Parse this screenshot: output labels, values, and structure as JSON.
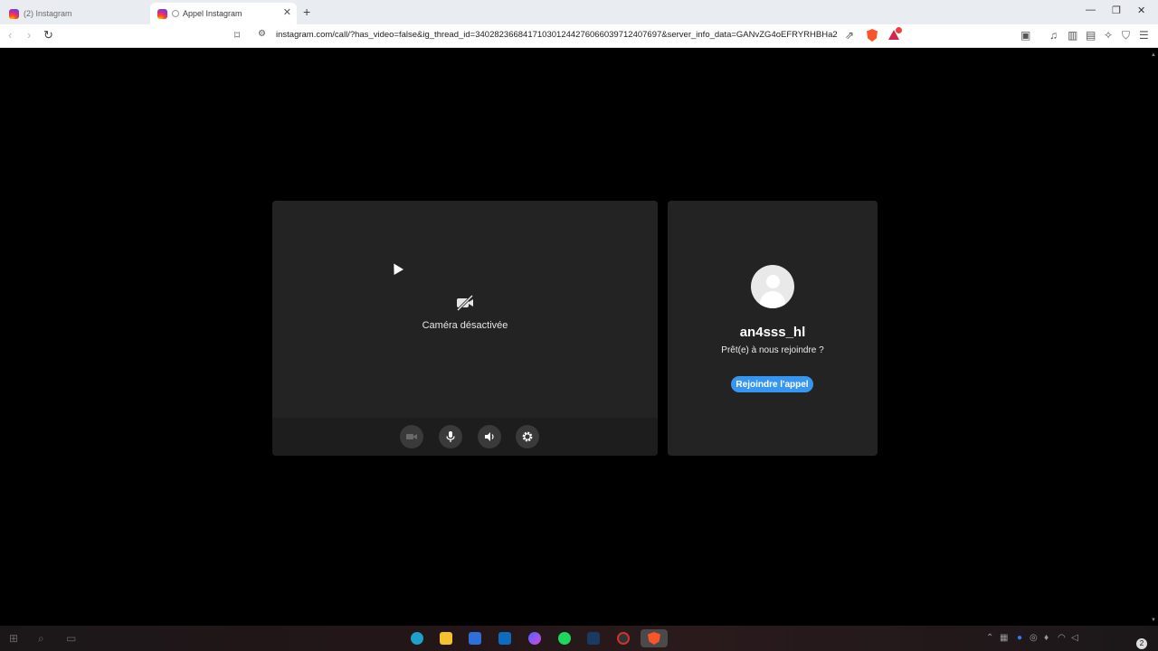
{
  "browser": {
    "tabs": [
      {
        "title": "(2) Instagram",
        "active": false
      },
      {
        "title": "Appel Instagram",
        "active": true
      }
    ],
    "new_tab": "+",
    "url": "instagram.com/call/?has_video=false&ig_thread_id=340282366841710301244276066039712407697&server_info_data=GANvZG4oEFRYRHBHa2Z5U...",
    "window_controls": {
      "minimize": "—",
      "maximize": "❐",
      "close": "✕"
    }
  },
  "call": {
    "camera_off_label": "Caméra désactivée",
    "controls": [
      {
        "name": "camera-toggle",
        "icon": "video-camera-icon"
      },
      {
        "name": "microphone-toggle",
        "icon": "microphone-icon"
      },
      {
        "name": "speaker-toggle",
        "icon": "speaker-icon"
      },
      {
        "name": "settings",
        "icon": "gear-icon"
      }
    ],
    "contact": {
      "username": "an4sss_hl",
      "prompt": "Prêt(e) à nous rejoindre ?",
      "join_label": "Rejoindre l'appel"
    }
  },
  "taskbar": {
    "notification_count": "2"
  },
  "colors": {
    "accent": "#3797f0",
    "panel": "#232323",
    "background": "#000000"
  }
}
